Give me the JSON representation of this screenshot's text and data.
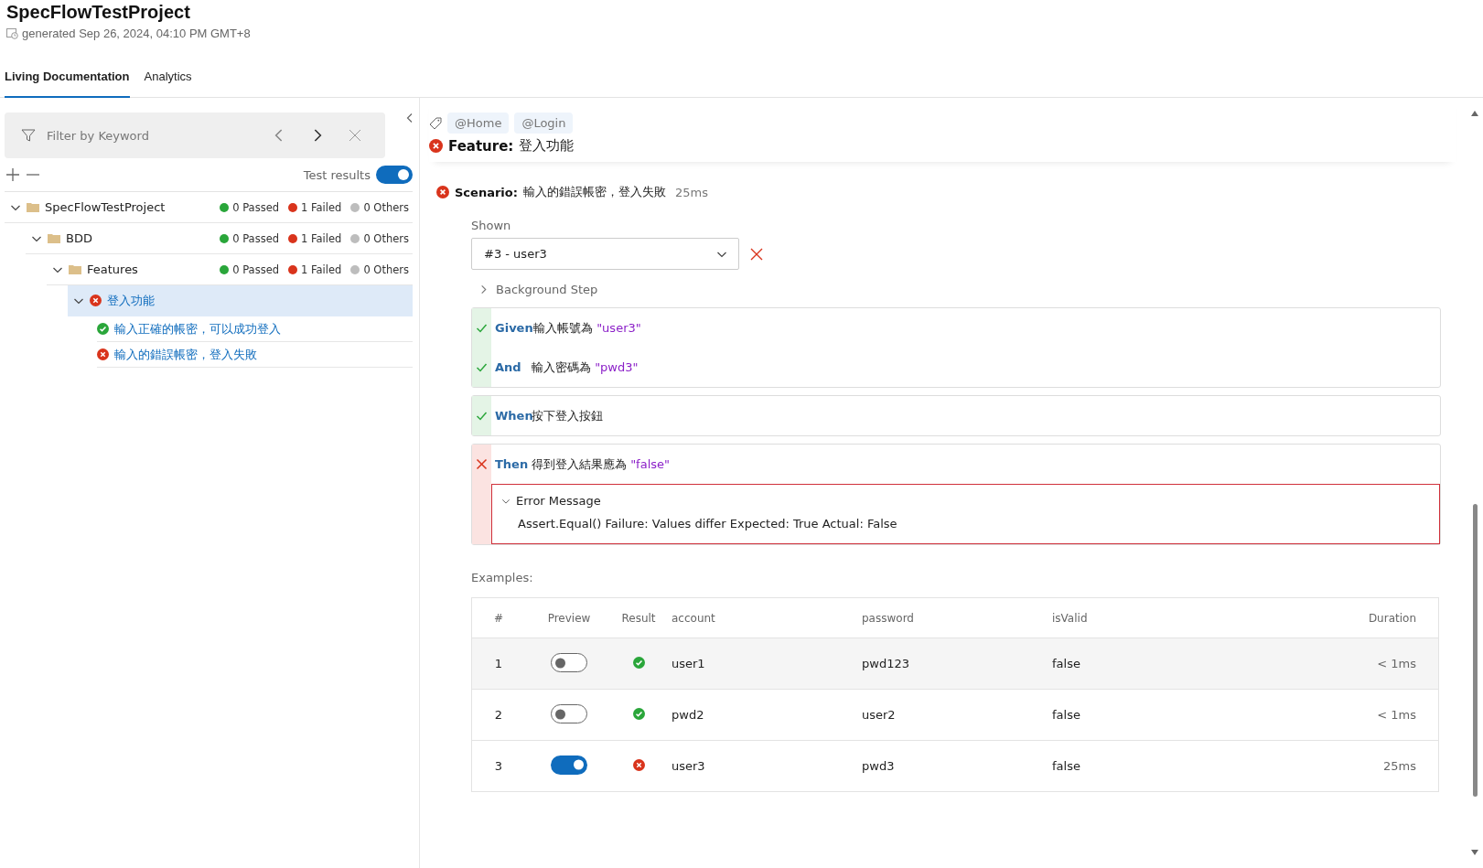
{
  "header": {
    "title": "SpecFlowTestProject",
    "generated": "generated Sep 26, 2024, 04:10 PM GMT+8"
  },
  "tabs": [
    {
      "label": "Living Documentation",
      "selected": true
    },
    {
      "label": "Analytics",
      "selected": false
    }
  ],
  "sidebar": {
    "filter": {
      "placeholder": "Filter by Keyword"
    },
    "test_results_label": "Test results",
    "test_results_on": true,
    "tree": [
      {
        "kind": "folder",
        "label": "SpecFlowTestProject",
        "expanded": true,
        "selected": false,
        "stats": [
          "0 Passed",
          "1 Failed",
          "0 Others"
        ],
        "children": [
          {
            "kind": "folder",
            "label": "BDD",
            "expanded": true,
            "selected": false,
            "stats": [
              "0 Passed",
              "1 Failed",
              "0 Others"
            ],
            "children": [
              {
                "kind": "folder",
                "label": "Features",
                "expanded": true,
                "selected": false,
                "stats": [
                  "0 Passed",
                  "1 Failed",
                  "0 Others"
                ],
                "children": [
                  {
                    "kind": "feature",
                    "label": "登入功能",
                    "failed": true,
                    "expanded": true,
                    "selected": true,
                    "children": [
                      {
                        "kind": "scenario",
                        "label": "輸入正確的帳密，可以成功登入",
                        "failed": false,
                        "selected": false
                      },
                      {
                        "kind": "scenario",
                        "label": "輸入的錯誤帳密，登入失敗",
                        "failed": true,
                        "selected": false
                      }
                    ]
                  }
                ]
              }
            ]
          }
        ]
      }
    ]
  },
  "feature": {
    "tags": [
      "@Home",
      "@Login"
    ],
    "keyword": "Feature:",
    "title": "登入功能",
    "failed": true
  },
  "scenario": {
    "keyword": "Scenario:",
    "title": "輸入的錯誤帳密，登入失敗",
    "duration": "25ms",
    "failed": true,
    "shown_label": "Shown",
    "shown_value": "#3 - user3",
    "background_label": "Background Step",
    "background_expanded": false,
    "step_groups": [
      [
        {
          "keyword": "Given",
          "text": "輸入帳號為",
          "arg": "\"user3\"",
          "failed": false
        },
        {
          "keyword": "And",
          "text": "輸入密碼為",
          "arg": "\"pwd3\"",
          "failed": false
        }
      ],
      [
        {
          "keyword": "When",
          "text": "按下登入按鈕",
          "failed": false
        }
      ],
      [
        {
          "keyword": "Then",
          "text": "得到登入結果應為",
          "arg": "\"false\"",
          "failed": true,
          "error_title": "Error Message",
          "error_expanded": true,
          "error": "Assert.Equal() Failure: Values differ Expected: True Actual: False"
        }
      ]
    ]
  },
  "examples": {
    "label": "Examples:",
    "columns": [
      "#",
      "Preview",
      "Result",
      "account",
      "password",
      "isValid",
      "Duration"
    ],
    "rows": [
      {
        "number": "1",
        "preview": false,
        "failed": false,
        "account": "user1",
        "password": "pwd123",
        "isValid": "false",
        "duration": "< 1ms",
        "highlighted": true
      },
      {
        "number": "2",
        "preview": false,
        "failed": false,
        "account": "pwd2",
        "password": "user2",
        "isValid": "false",
        "duration": "< 1ms",
        "highlighted": false
      },
      {
        "number": "3",
        "preview": true,
        "failed": true,
        "account": "user3",
        "password": "pwd3",
        "isValid": "false",
        "duration": "25ms",
        "highlighted": false
      }
    ]
  }
}
